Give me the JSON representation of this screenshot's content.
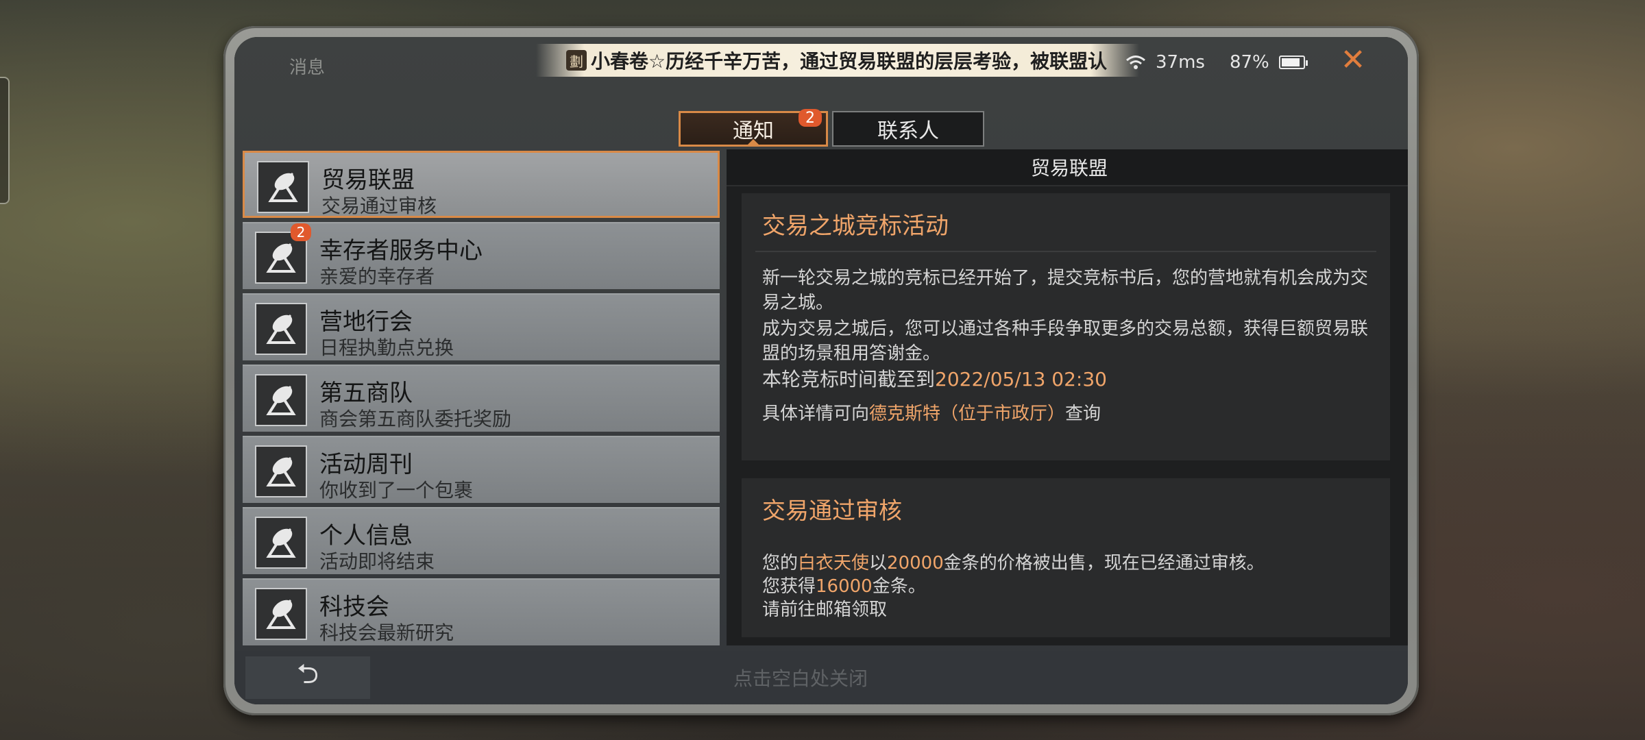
{
  "header": {
    "title": "消息",
    "marquee_icon": "劃",
    "marquee_text": "小春卷☆历经千辛万苦，通过贸易联盟的层层考验，被联盟认",
    "ping": "37ms",
    "battery": "87%",
    "battery_level": 0.87,
    "close_symbol": "✕"
  },
  "tabs": [
    {
      "label": "通知",
      "badge": "2"
    },
    {
      "label": "联系人"
    }
  ],
  "list": [
    {
      "title": "贸易联盟",
      "subtitle": "交易通过审核"
    },
    {
      "title": "幸存者服务中心",
      "subtitle": "亲爱的幸存者",
      "badge": "2"
    },
    {
      "title": "营地行会",
      "subtitle": "日程执勤点兑换"
    },
    {
      "title": "第五商队",
      "subtitle": "商会第五商队委托奖励"
    },
    {
      "title": "活动周刊",
      "subtitle": "你收到了一个包裹"
    },
    {
      "title": "个人信息",
      "subtitle": "活动即将结束"
    },
    {
      "title": "科技会",
      "subtitle": "科技会最新研究"
    }
  ],
  "detail": {
    "header": "贸易联盟",
    "card1": {
      "title": "交易之城竞标活动",
      "p1": "新一轮交易之城的竞标已经开始了，提交竞标书后，您的营地就有机会成为交易之城。",
      "p2": "成为交易之城后，您可以通过各种手段争取更多的交易总额，获得巨额贸易联盟的场景租用答谢金。",
      "p3_prefix": "本轮竞标时间截至到",
      "p3_time": "2022/05/13 02:30",
      "p4_prefix": "具体详情可向",
      "p4_link": "德克斯特（位于市政厅）",
      "p4_suffix": "查询"
    },
    "card2": {
      "title": "交易通过审核",
      "l1_a": "您的",
      "l1_item": "白衣天使",
      "l1_b": "以",
      "l1_price": "20000",
      "l1_c": "金条的价格被出售，现在已经通过审核。",
      "l2_a": "您获得",
      "l2_amount": "16000",
      "l2_b": "金条。",
      "l3": "请前往邮箱领取"
    }
  },
  "footer": {
    "back_symbol": "⮌",
    "hint": "点击空白处关闭"
  }
}
